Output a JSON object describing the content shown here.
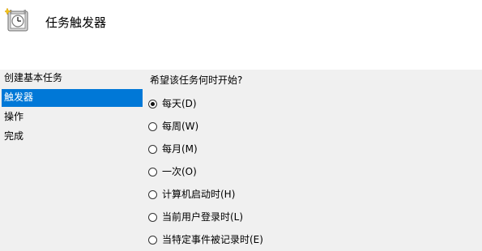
{
  "header": {
    "title": "任务触发器",
    "icon": "task-scheduler-icon"
  },
  "nav": {
    "items": [
      {
        "label": "创建基本任务",
        "selected": false
      },
      {
        "label": "触发器",
        "selected": true
      },
      {
        "label": "操作",
        "selected": false
      },
      {
        "label": "完成",
        "selected": false
      }
    ],
    "selected_color": "#0078d7"
  },
  "trigger": {
    "question": "希望该任务何时开始?",
    "options": [
      {
        "label": "每天(D)",
        "checked": true
      },
      {
        "label": "每周(W)",
        "checked": false
      },
      {
        "label": "每月(M)",
        "checked": false
      },
      {
        "label": "一次(O)",
        "checked": false
      },
      {
        "label": "计算机启动时(H)",
        "checked": false
      },
      {
        "label": "当前用户登录时(L)",
        "checked": false
      },
      {
        "label": "当特定事件被记录时(E)",
        "checked": false
      }
    ]
  }
}
